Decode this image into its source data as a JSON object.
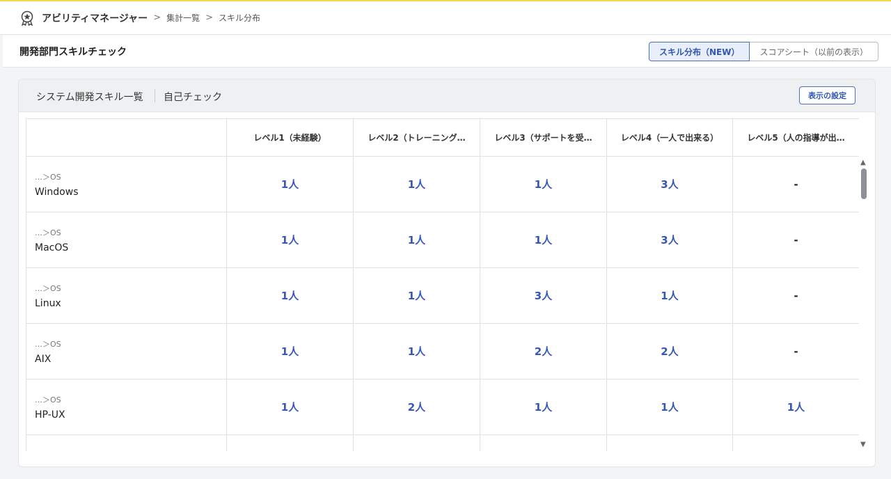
{
  "header": {
    "app_name": "アビリティマネージャー",
    "breadcrumb": [
      "集計一覧",
      "スキル分布"
    ],
    "separator": ">"
  },
  "page": {
    "title": "開発部門スキルチェック",
    "view_toggle": [
      "スキル分布（NEW）",
      "スコアシート（以前の表示）"
    ]
  },
  "card": {
    "tabs": [
      "システム開発スキル一覧",
      "自己チェック"
    ],
    "settings_label": "表示の設定"
  },
  "table": {
    "columns": [
      "",
      "レベル1（未経験）",
      "レベル2（トレーニング…",
      "レベル3（サポートを受…",
      "レベル4（一人で出来る）",
      "レベル5（人の指導が出…"
    ],
    "rows": [
      {
        "path": "…＞OS",
        "name": "Windows",
        "values": [
          "1人",
          "1人",
          "1人",
          "3人",
          "-"
        ]
      },
      {
        "path": "…＞OS",
        "name": "MacOS",
        "values": [
          "1人",
          "1人",
          "1人",
          "3人",
          "-"
        ]
      },
      {
        "path": "…＞OS",
        "name": "Linux",
        "values": [
          "1人",
          "1人",
          "3人",
          "1人",
          "-"
        ]
      },
      {
        "path": "…＞OS",
        "name": "AIX",
        "values": [
          "1人",
          "1人",
          "2人",
          "2人",
          "-"
        ]
      },
      {
        "path": "…＞OS",
        "name": "HP-UX",
        "values": [
          "1人",
          "2人",
          "1人",
          "1人",
          "1人"
        ]
      },
      {
        "path": "…＞OS",
        "name": "",
        "values": [
          "",
          "",
          "",
          "",
          ""
        ]
      }
    ]
  },
  "colors": {
    "accent": "#3558b8",
    "top_bar": "#f2d94b"
  },
  "icons": {
    "app": "award-badge-icon",
    "scroll_up": "triangle-up-icon",
    "scroll_down": "triangle-down-icon"
  }
}
